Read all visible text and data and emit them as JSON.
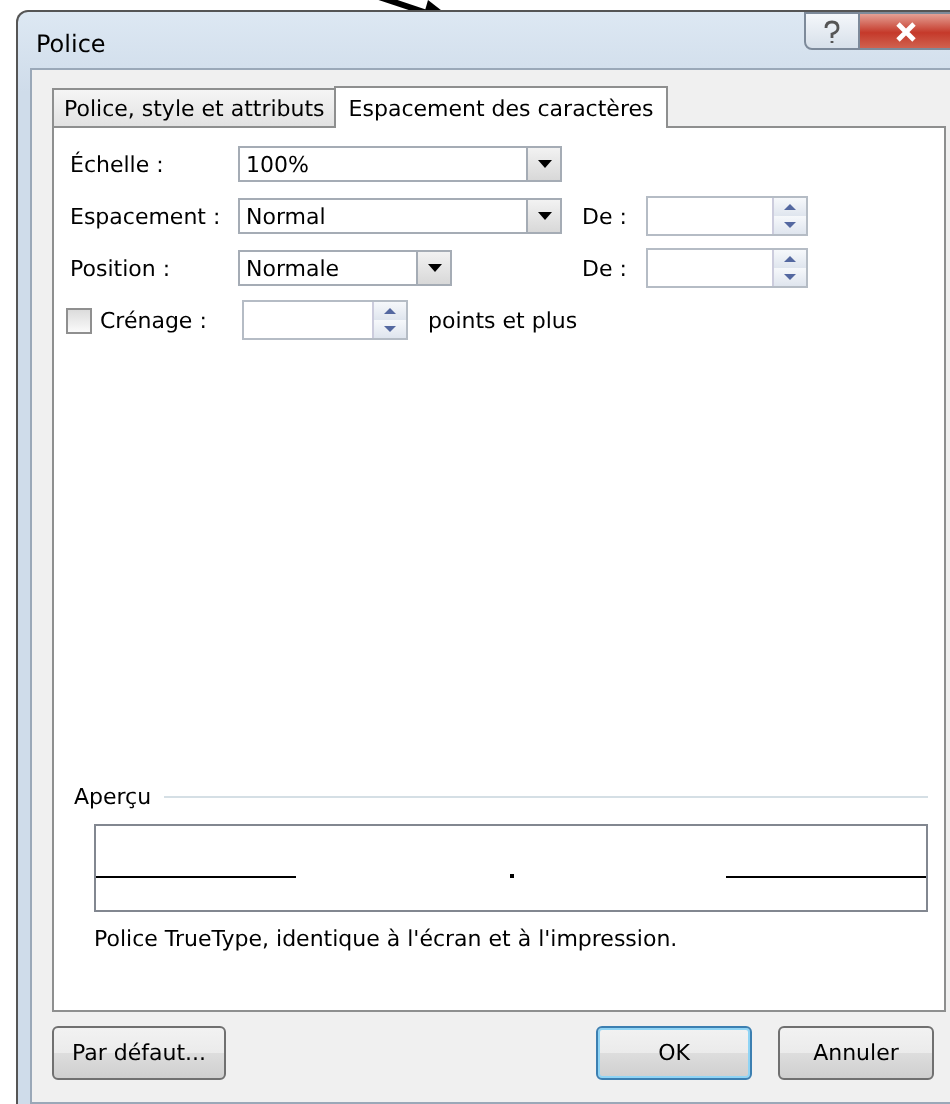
{
  "window": {
    "title": "Police"
  },
  "tabs": [
    {
      "label": "Police, style et attributs",
      "selected": false
    },
    {
      "label": "Espacement des caractères",
      "selected": true
    }
  ],
  "rows": [
    {
      "kind": "combo",
      "label": "Échelle :",
      "value": "100%"
    },
    {
      "kind": "combo",
      "label": "Espacement :",
      "value": "Normal",
      "extra_label": "De :"
    },
    {
      "kind": "combo",
      "label": "Position :",
      "value": "Normale",
      "extra_label": "De :"
    },
    {
      "kind": "checkspin",
      "label": "Crénage :",
      "checked": false,
      "suffix": "points et plus"
    }
  ],
  "preview": {
    "title": "Aperçu",
    "note": "Police TrueType, identique à l'écran et à l'impression."
  },
  "buttons": [
    {
      "label": "Par défaut...",
      "default": false
    },
    {
      "label": "OK",
      "default": true
    },
    {
      "label": "Annuler",
      "default": false
    }
  ]
}
